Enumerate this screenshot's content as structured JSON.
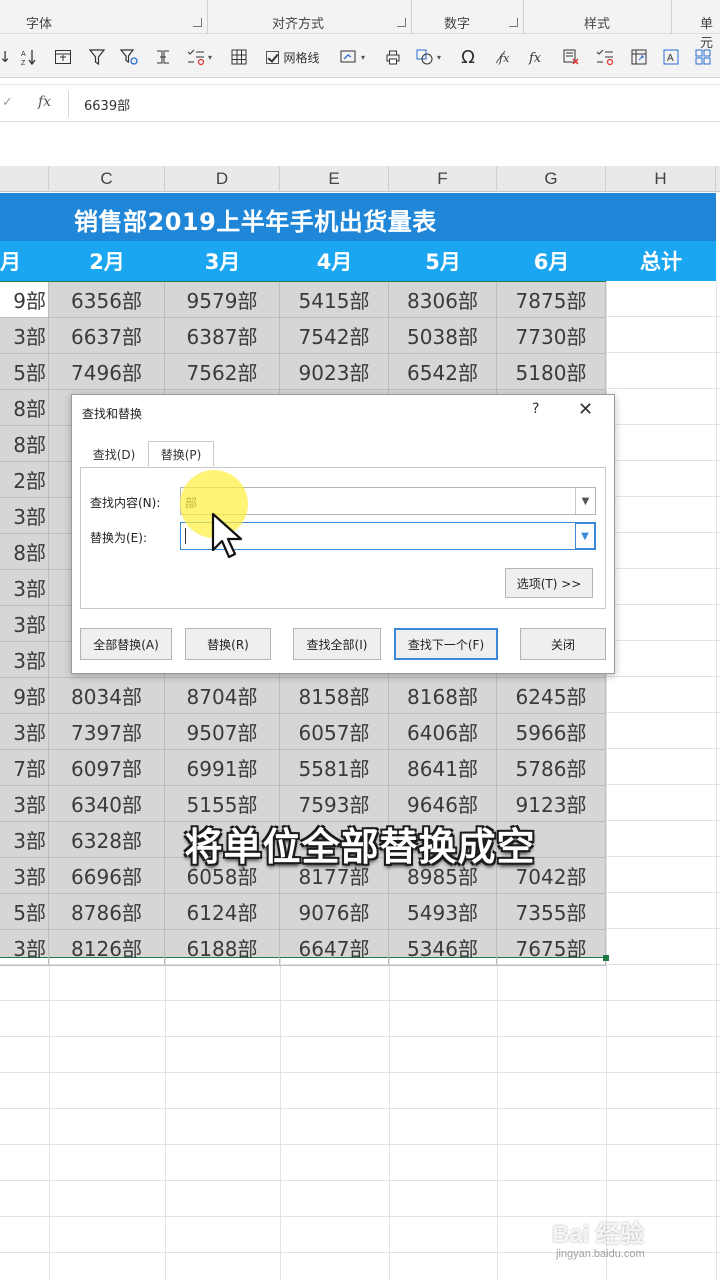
{
  "ribbon": {
    "groups": [
      "字体",
      "对齐方式",
      "数字",
      "样式",
      "单元"
    ],
    "gridlines_label": "网格线",
    "tools": [
      "sort-icon",
      "sort-az-icon",
      "table-icon",
      "filter-icon",
      "advanced-filter-icon",
      "merge-icon",
      "validation-icon",
      "grid-icon",
      "checkbox-icon",
      "chart-icon",
      "print-icon",
      "shapes-icon",
      "omega-icon",
      "formula-icon",
      "fx-icon",
      "delete-icon",
      "validation2-icon",
      "textbox-icon",
      "pivot-icon"
    ]
  },
  "formula_bar": {
    "fx_label": "fx",
    "value": "6639部"
  },
  "columns": [
    "C",
    "D",
    "E",
    "F",
    "G",
    "H"
  ],
  "sheet": {
    "title": "销售部2019上半年手机出货量表",
    "first_month_fragment": "月",
    "months": [
      "2月",
      "3月",
      "4月",
      "5月",
      "6月"
    ],
    "total_label": "总计",
    "first_col": [
      "9部",
      "3部",
      "5部",
      "8部",
      "8部",
      "2部",
      "3部",
      "8部",
      "3部",
      "3部",
      "3部",
      "9部",
      "3部",
      "7部",
      "3部",
      "3部",
      "3部",
      "5部",
      "3部"
    ],
    "rows": [
      [
        "6356部",
        "9579部",
        "5415部",
        "8306部",
        "7875部"
      ],
      [
        "6637部",
        "6387部",
        "7542部",
        "5038部",
        "7730部"
      ],
      [
        "7496部",
        "7562部",
        "9023部",
        "6542部",
        "5180部"
      ],
      [
        "",
        "",
        "",
        "",
        ""
      ],
      [
        "",
        "",
        "",
        "",
        ""
      ],
      [
        "",
        "",
        "",
        "",
        ""
      ],
      [
        "",
        "",
        "",
        "",
        ""
      ],
      [
        "",
        "",
        "",
        "",
        ""
      ],
      [
        "",
        "",
        "",
        "",
        ""
      ],
      [
        "",
        "",
        "",
        "",
        ""
      ],
      [
        "",
        "",
        "",
        "",
        ""
      ],
      [
        "8034部",
        "8704部",
        "8158部",
        "8168部",
        "6245部"
      ],
      [
        "7397部",
        "9507部",
        "6057部",
        "6406部",
        "5966部"
      ],
      [
        "6097部",
        "6991部",
        "5581部",
        "8641部",
        "5786部"
      ],
      [
        "6340部",
        "5155部",
        "7593部",
        "9646部",
        "9123部"
      ],
      [
        "6328部",
        "",
        "",
        "",
        ""
      ],
      [
        "6696部",
        "6058部",
        "8177部",
        "8985部",
        "7042部"
      ],
      [
        "8786部",
        "6124部",
        "9076部",
        "5493部",
        "7355部"
      ],
      [
        "8126部",
        "6188部",
        "6647部",
        "5346部",
        "7675部"
      ]
    ]
  },
  "dialog": {
    "title": "查找和替换",
    "help": "?",
    "close": "✕",
    "tab_find": "查找(D)",
    "tab_replace": "替换(P)",
    "find_label": "查找内容(N):",
    "find_value": "部",
    "replace_label": "替换为(E):",
    "replace_value": "",
    "options_button": "选项(T) >>",
    "replace_all_button": "全部替换(A)",
    "replace_button": "替换(R)",
    "find_all_button": "查找全部(I)",
    "find_next_button": "查找下一个(F)",
    "close_button": "关闭"
  },
  "subtitle": "将单位全部替换成空",
  "watermark": {
    "brand": "Bai 经验",
    "url": "jingyan.baidu.com"
  }
}
